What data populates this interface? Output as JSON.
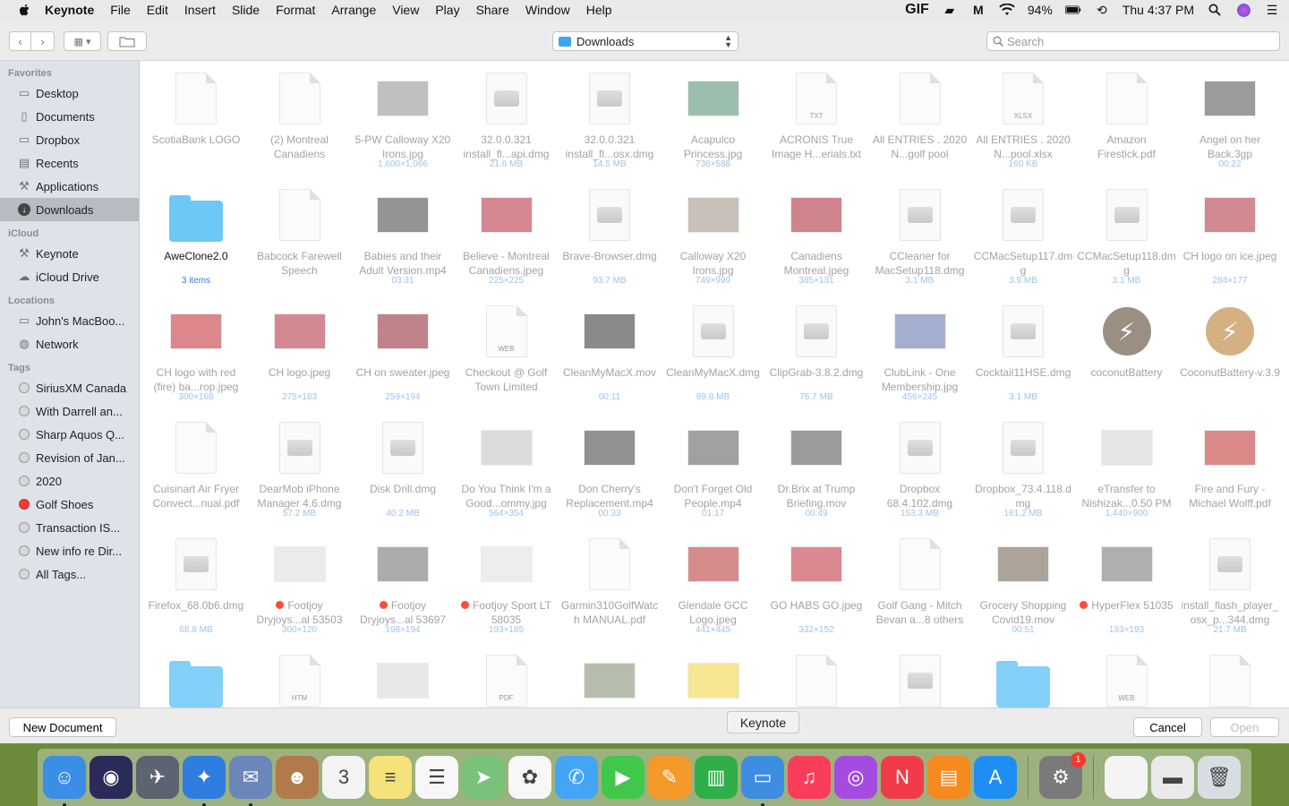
{
  "menubar": {
    "app_name": "Keynote",
    "menus": [
      "File",
      "Edit",
      "Insert",
      "Slide",
      "Format",
      "Arrange",
      "View",
      "Play",
      "Share",
      "Window",
      "Help"
    ],
    "gif_label": "GIF",
    "battery": "94%",
    "clock": "Thu 4:37 PM"
  },
  "toolbar": {
    "location": "Downloads",
    "search_placeholder": "Search"
  },
  "sidebar": {
    "favorites_header": "Favorites",
    "favorites": [
      {
        "label": "Desktop",
        "icon": "desktop-icon"
      },
      {
        "label": "Documents",
        "icon": "documents-icon"
      },
      {
        "label": "Dropbox",
        "icon": "folder-icon"
      },
      {
        "label": "Recents",
        "icon": "recents-icon"
      },
      {
        "label": "Applications",
        "icon": "applications-icon"
      },
      {
        "label": "Downloads",
        "icon": "downloads-icon",
        "selected": true
      }
    ],
    "icloud_header": "iCloud",
    "icloud": [
      {
        "label": "Keynote",
        "icon": "applications-icon"
      },
      {
        "label": "iCloud Drive",
        "icon": "cloud-icon"
      }
    ],
    "locations_header": "Locations",
    "locations": [
      {
        "label": "John's MacBoo...",
        "icon": "laptop-icon"
      },
      {
        "label": "Network",
        "icon": "globe-icon"
      }
    ],
    "tags_header": "Tags",
    "tags": [
      {
        "label": "SiriusXM Canada",
        "color": "#d8d8d8"
      },
      {
        "label": "With Darrell an...",
        "color": "#d8d8d8"
      },
      {
        "label": "Sharp Aquos Q...",
        "color": "#d8d8d8"
      },
      {
        "label": "Revision of Jan...",
        "color": "#d8d8d8"
      },
      {
        "label": "2020",
        "color": "#d8d8d8"
      },
      {
        "label": "Golf Shoes",
        "color": "#f13b3b"
      },
      {
        "label": "Transaction IS...",
        "color": "#d8d8d8"
      },
      {
        "label": "New info re Dir...",
        "color": "#d8d8d8"
      },
      {
        "label": "All Tags...",
        "color": "#d8d8d8"
      }
    ]
  },
  "files": [
    {
      "name": "ScotiaBank LOGO",
      "meta": "",
      "kind": "doc"
    },
    {
      "name": "(2) Montreal Canadiens",
      "meta": "",
      "kind": "doc"
    },
    {
      "name": "5-PW Calloway X20 Irons.jpg",
      "meta": "1,600×1,066",
      "kind": "img",
      "color": "#8d8d8d"
    },
    {
      "name": "32.0.0.321 install_fl...api.dmg",
      "meta": "21.6 MB",
      "kind": "dmg"
    },
    {
      "name": "32.0.0.321 install_fl...osx.dmg",
      "meta": "14.5 MB",
      "kind": "dmg"
    },
    {
      "name": "Acapulco Princess.jpg",
      "meta": "736×588",
      "kind": "img",
      "color": "#4d8a6a"
    },
    {
      "name": "ACRONIS True Image H...erials.txt",
      "meta": "",
      "kind": "doc",
      "badge": "TXT"
    },
    {
      "name": "All ENTRIES . 2020 N...golf pool",
      "meta": "",
      "kind": "doc"
    },
    {
      "name": "All ENTRIES . 2020 N...pool.xlsx",
      "meta": "160 KB",
      "kind": "doc",
      "badge": "XLSX"
    },
    {
      "name": "Amazon Firestick.pdf",
      "meta": "",
      "kind": "doc"
    },
    {
      "name": "Angel on her Back.3gp",
      "meta": "00:22",
      "kind": "img",
      "color": "#4a4a4a"
    },
    {
      "name": "AweClone2.0",
      "meta": "3 items",
      "kind": "folder",
      "active": true
    },
    {
      "name": "Babcock Farewell Speech",
      "meta": "",
      "kind": "doc"
    },
    {
      "name": "Babies and their Adult Version.mp4",
      "meta": "03:31",
      "kind": "img",
      "color": "#3d3d3d"
    },
    {
      "name": "Believe - Montreal Canadiens.jpeg",
      "meta": "225×225",
      "kind": "img",
      "color": "#b3263a"
    },
    {
      "name": "Brave-Browser.dmg",
      "meta": "93.7 MB",
      "kind": "dmg"
    },
    {
      "name": "Calloway X20 Irons.jpg",
      "meta": "749×999",
      "kind": "img",
      "color": "#9c8f80"
    },
    {
      "name": "Canadiens Montreal.jpeg",
      "meta": "385×131",
      "kind": "img",
      "color": "#a82031"
    },
    {
      "name": "CCleaner for MacSetup118.dmg",
      "meta": "3.1 MB",
      "kind": "dmg"
    },
    {
      "name": "CCMacSetup117.dmg",
      "meta": "3.9 MB",
      "kind": "dmg"
    },
    {
      "name": "CCMacSetup118.dmg",
      "meta": "3.1 MB",
      "kind": "dmg"
    },
    {
      "name": "CH logo on ice.jpeg",
      "meta": "284×177",
      "kind": "img",
      "color": "#b02a3a"
    },
    {
      "name": "CH logo with red (fire) ba...rop.jpeg",
      "meta": "300×168",
      "kind": "img",
      "color": "#c0262d"
    },
    {
      "name": "CH logo.jpeg",
      "meta": "275×183",
      "kind": "img",
      "color": "#b22a3a"
    },
    {
      "name": "CH on sweater.jpeg",
      "meta": "259×194",
      "kind": "img",
      "color": "#8e1e2a"
    },
    {
      "name": "Checkout @ Golf Town Limited",
      "meta": "",
      "kind": "doc",
      "badge": "WEB"
    },
    {
      "name": "CleanMyMacX.mov",
      "meta": "00:11",
      "kind": "img",
      "color": "#2c2c2c"
    },
    {
      "name": "CleanMyMacX.dmg",
      "meta": "69.8 MB",
      "kind": "dmg"
    },
    {
      "name": "ClipGrab-3.8.2.dmg",
      "meta": "76.7 MB",
      "kind": "dmg"
    },
    {
      "name": "ClubLink - One Membership.jpg",
      "meta": "456×245",
      "kind": "img",
      "color": "#5a6fa8"
    },
    {
      "name": "Cocktail11HSE.dmg",
      "meta": "3.1 MB",
      "kind": "dmg"
    },
    {
      "name": "coconutBattery",
      "meta": "",
      "kind": "round",
      "color": "#7a6a5a"
    },
    {
      "name": "CoconutBattery-v.3.9",
      "meta": "",
      "kind": "round",
      "color": "#c8965a"
    },
    {
      "name": "Cuisinart Air Fryer Convect...nual.pdf",
      "meta": "",
      "kind": "doc"
    },
    {
      "name": "DearMob iPhone Manager 4.6.dmg",
      "meta": "57.2 MB",
      "kind": "dmg"
    },
    {
      "name": "Disk Drill.dmg",
      "meta": "40.2 MB",
      "kind": "dmg"
    },
    {
      "name": "Do You Think I'm a Good...ommy.jpg",
      "meta": "564×354",
      "kind": "img",
      "color": "#c0c0c0"
    },
    {
      "name": "Don Cherry's Replacement.mp4",
      "meta": "00:33",
      "kind": "img",
      "color": "#3a3a3a"
    },
    {
      "name": "Don't Forget Old People.mp4",
      "meta": "01:17",
      "kind": "img",
      "color": "#555555"
    },
    {
      "name": "Dr.Brix at Trump Briefing.mov",
      "meta": "00:49",
      "kind": "img",
      "color": "#4a4a4a"
    },
    {
      "name": "Dropbox 68.4.102.dmg",
      "meta": "153.3 MB",
      "kind": "dmg"
    },
    {
      "name": "Dropbox_73.4.118.dmg",
      "meta": "161.2 MB",
      "kind": "dmg"
    },
    {
      "name": "eTransfer to Nishizak...0.50 PM",
      "meta": "1,440×900",
      "kind": "img",
      "color": "#d0d0d0"
    },
    {
      "name": "Fire and Fury - Michael Wolff.pdf",
      "meta": "",
      "kind": "img",
      "color": "#c02a2a"
    },
    {
      "name": "Firefox_68.0b6.dmg",
      "meta": "68.8 MB",
      "kind": "dmg"
    },
    {
      "name": "Footjoy Dryjoys...al 53503",
      "meta": "300×120",
      "kind": "img",
      "color": "#dcdcdc",
      "tag": true
    },
    {
      "name": "Footjoy Dryjoys...al 53697",
      "meta": "198×194",
      "kind": "img",
      "color": "#6a6a6a",
      "tag": true
    },
    {
      "name": "Footjoy Sport LT 58035",
      "meta": "193×185",
      "kind": "img",
      "color": "#e0e0e0",
      "tag": true
    },
    {
      "name": "Garmin310GolfWatch MANUAL.pdf",
      "meta": "",
      "kind": "doc"
    },
    {
      "name": "Glendale GCC Logo.jpeg",
      "meta": "441×445",
      "kind": "img",
      "color": "#b83030"
    },
    {
      "name": "GO HABS GO.jpeg",
      "meta": "332×152",
      "kind": "img",
      "color": "#c02838"
    },
    {
      "name": "Golf Gang - Mitch Bevan a...8 others",
      "meta": "",
      "kind": "doc"
    },
    {
      "name": "Grocery Shopping Covid19.mov",
      "meta": "00:51",
      "kind": "img",
      "color": "#6a5a4a"
    },
    {
      "name": "HyperFlex 51035",
      "meta": "193×193",
      "kind": "img",
      "color": "#707070",
      "tag": true
    },
    {
      "name": "install_flash_player_osx_p...344.dmg",
      "meta": "21.7 MB",
      "kind": "dmg"
    },
    {
      "name": "",
      "meta": "",
      "kind": "folder"
    },
    {
      "name": "",
      "meta": "",
      "kind": "doc",
      "badge": "HTM"
    },
    {
      "name": "",
      "meta": "",
      "kind": "img",
      "color": "#d6d6d6"
    },
    {
      "name": "",
      "meta": "",
      "kind": "doc",
      "badge": "PDF"
    },
    {
      "name": "",
      "meta": "",
      "kind": "img",
      "color": "#7a8a6a"
    },
    {
      "name": "",
      "meta": "",
      "kind": "img",
      "color": "#f0d23a"
    },
    {
      "name": "",
      "meta": "",
      "kind": "doc"
    },
    {
      "name": "",
      "meta": "",
      "kind": "dmg"
    },
    {
      "name": "",
      "meta": "",
      "kind": "folder"
    },
    {
      "name": "",
      "meta": "",
      "kind": "doc",
      "badge": "WEB"
    },
    {
      "name": "",
      "meta": "",
      "kind": "doc"
    }
  ],
  "footer": {
    "new_document": "New Document",
    "cancel": "Cancel",
    "open": "Open",
    "tooltip": "Keynote"
  },
  "dock": [
    {
      "name": "finder-icon",
      "color": "#3a8ee6",
      "glyph": "☺",
      "running": true
    },
    {
      "name": "siri-icon",
      "color": "#2b2b5a",
      "glyph": "◉"
    },
    {
      "name": "launchpad-icon",
      "color": "#5b6470",
      "glyph": "✈"
    },
    {
      "name": "safari-icon",
      "color": "#2f7de1",
      "glyph": "✦",
      "running": true
    },
    {
      "name": "mail-eagle-icon",
      "color": "#6b86b8",
      "glyph": "✉",
      "running": true
    },
    {
      "name": "contacts-icon",
      "color": "#b07a4a",
      "glyph": "☻"
    },
    {
      "name": "calendar-icon",
      "color": "#f4f4f4",
      "glyph": "3"
    },
    {
      "name": "notes-icon",
      "color": "#f6e27a",
      "glyph": "≡"
    },
    {
      "name": "reminders-icon",
      "color": "#f7f7f7",
      "glyph": "☰"
    },
    {
      "name": "maps-icon",
      "color": "#7ac27a",
      "glyph": "➤"
    },
    {
      "name": "photos-icon",
      "color": "#f7f7f7",
      "glyph": "✿"
    },
    {
      "name": "messages-icon",
      "color": "#43a5f5",
      "glyph": "✆"
    },
    {
      "name": "facetime-icon",
      "color": "#3fc84a",
      "glyph": "▶"
    },
    {
      "name": "pages-icon",
      "color": "#f39a2a",
      "glyph": "✎"
    },
    {
      "name": "numbers-icon",
      "color": "#2fae4a",
      "glyph": "▥"
    },
    {
      "name": "keynote-icon",
      "color": "#3d8ee0",
      "glyph": "▭",
      "running": true
    },
    {
      "name": "music-icon",
      "color": "#fa3e5a",
      "glyph": "♫"
    },
    {
      "name": "podcasts-icon",
      "color": "#a54ce0",
      "glyph": "◎"
    },
    {
      "name": "news-icon",
      "color": "#f23b4a",
      "glyph": "N"
    },
    {
      "name": "books-icon",
      "color": "#f58a1e",
      "glyph": "▤"
    },
    {
      "name": "app-store-icon",
      "color": "#1e8ef5",
      "glyph": "A"
    },
    {
      "name": "system-preferences-icon",
      "color": "#7a7a7a",
      "glyph": "⚙",
      "badge": "1",
      "separator_before": true
    },
    {
      "name": "document-icon",
      "color": "#f4f4f4",
      "glyph": "",
      "separator_before": true
    },
    {
      "name": "screenshot-icon",
      "color": "#eaeaea",
      "glyph": "▬"
    },
    {
      "name": "trash-icon",
      "color": "#d8dde2",
      "glyph": "🗑"
    }
  ]
}
